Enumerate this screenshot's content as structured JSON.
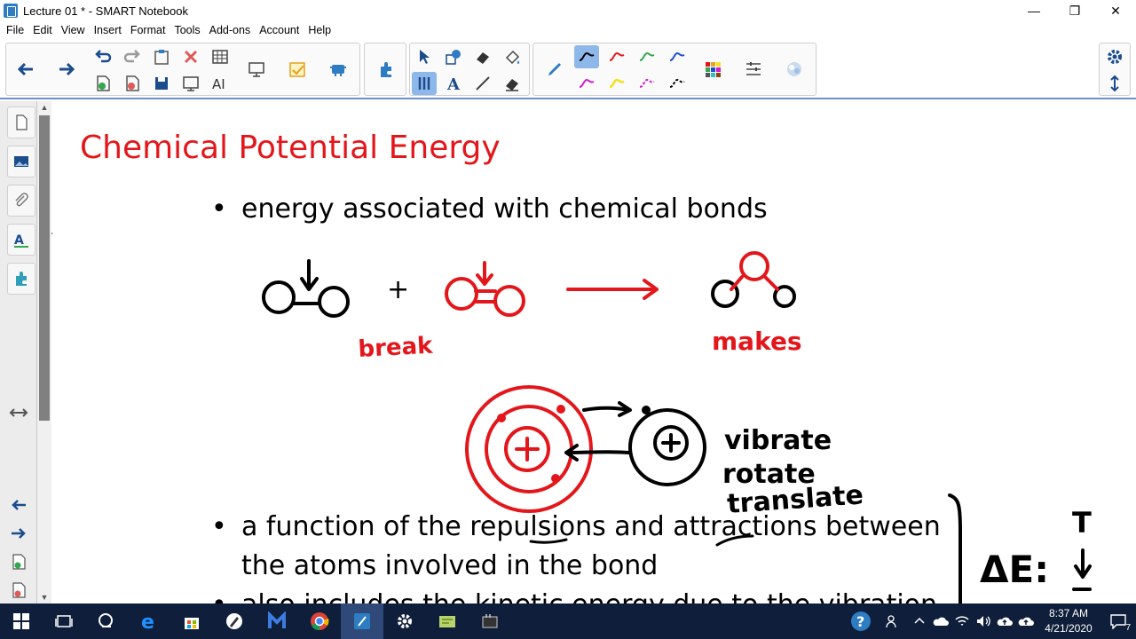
{
  "window": {
    "title": "Lecture 01 * - SMART Notebook",
    "controls": {
      "minimize": "—",
      "restore": "❐",
      "close": "✕"
    }
  },
  "menu": [
    "File",
    "Edit",
    "View",
    "Insert",
    "Format",
    "Tools",
    "Add-ons",
    "Account",
    "Help"
  ],
  "toolbar": {
    "icons": [
      "back-arrow",
      "forward-arrow",
      "undo",
      "redo",
      "paste",
      "delete",
      "table",
      "add-page",
      "delete-page",
      "save",
      "screen-shade",
      "text-recognition",
      "display",
      "response",
      "activity-builder",
      "add-ons",
      "select",
      "shapes",
      "eraser-fill",
      "fill",
      "pens",
      "text",
      "line",
      "eraser",
      "pen",
      "black-line",
      "red-line",
      "green-line",
      "blue-line",
      "magenta-line",
      "yellow-line",
      "magenta-dash-line",
      "black-dash-line",
      "fill-color",
      "line-properties",
      "creative-pen",
      "settings",
      "move-toolbar"
    ],
    "accent_color": "#8fb8ea"
  },
  "sidebar": {
    "tabs": [
      "page-sorter",
      "gallery",
      "attachments",
      "properties",
      "add-ons"
    ],
    "bottom_icons": [
      "resize",
      "previous-page",
      "next-page",
      "add-page",
      "delete-page"
    ]
  },
  "slide": {
    "title": "Chemical Potential Energy",
    "title_color": "#e3171b",
    "bullets": [
      "energy associated with chemical bonds",
      "a function of the repulsions and attractions between",
      "the atoms involved in the bond",
      "also includes the kinetic energy due to the vibration"
    ],
    "bullet_mark": "•",
    "handwriting": {
      "plus": "+",
      "break": "break",
      "makes": "makes",
      "vibrate": "vibrate",
      "rotate": "rotate",
      "translate": "translate",
      "delta_e": "ΔE:",
      "t": "T"
    }
  },
  "taskbar": {
    "apps": [
      "windows-start",
      "task-view",
      "cortana",
      "edge",
      "store",
      "inkscape",
      "malwarebytes",
      "chrome",
      "smart-notebook",
      "settings",
      "notebook-document",
      "typing-app"
    ],
    "tray": {
      "time": "8:37 AM",
      "date": "4/21/2020",
      "notifications": "7"
    }
  }
}
